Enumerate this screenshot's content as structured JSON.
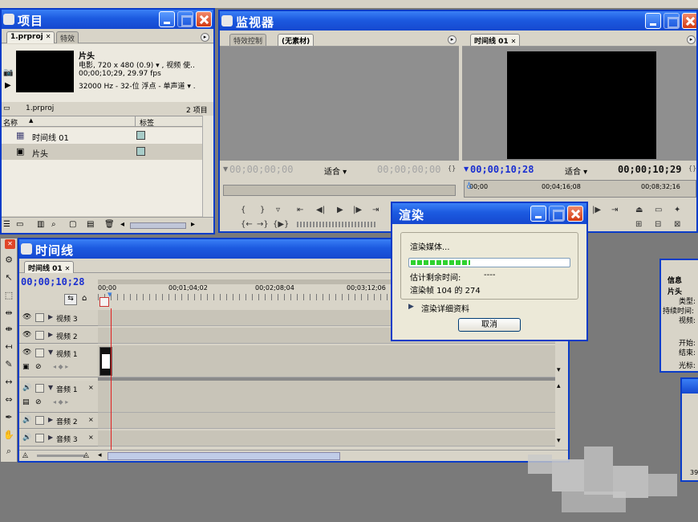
{
  "project": {
    "title": "项目",
    "tab_project": "1.prproj",
    "tab_effects": "特效",
    "clip_name": "片头",
    "clip_info1": "电影, 720 x 480 (0.9)  ▾ , 视频 使..",
    "clip_info2": "00;00;10;29, 29.97 fps",
    "clip_info3": "32000 Hz - 32-位 浮点 - 单声道  ▾ .",
    "bin_name": "1.prproj",
    "item_count": "2 项目",
    "col_name": "名称",
    "col_label": "标签",
    "items": [
      {
        "name": "时间线 01"
      },
      {
        "name": "片头"
      }
    ]
  },
  "monitor": {
    "title": "监视器",
    "tab_effects_ctrl": "特效控制",
    "tab_no_clip": "(无素材)",
    "src_time_left": "00;00;00;00",
    "src_fit": "适合",
    "src_time_right": "00;00;00;00",
    "prog_tab": "时间线 01",
    "prog_time_left": "00;00;10;28",
    "prog_fit": "适合",
    "prog_time_right": "00;00;10;29",
    "ruler": [
      "00;00",
      "00;04;16;08",
      "00;08;32;16"
    ]
  },
  "timeline": {
    "title": "时间线",
    "tab": "时间线 01",
    "timecode": "00;00;10;28",
    "ruler": [
      "00;00",
      "00;01;04;02",
      "00;02;08;04",
      "00;03;12;06"
    ],
    "tracks": [
      {
        "name": "视频 3"
      },
      {
        "name": "视频 2"
      },
      {
        "name": "视频 1"
      },
      {
        "name": "音频 1"
      },
      {
        "name": "音频 2"
      },
      {
        "name": "音频 3"
      }
    ]
  },
  "render_dialog": {
    "title": "渲染",
    "status": "渲染媒体...",
    "progress_fraction": 0.38,
    "eta_label": "估计剩余时间:",
    "eta_value": "----",
    "frames": "渲染帧 104 的 274",
    "details": "渲染详细资料",
    "cancel": "取消"
  },
  "info": {
    "title": "信息",
    "clip": "片头",
    "fields": [
      "类型:",
      "持续时间:",
      "视频:",
      "开始:",
      "结束:",
      "光标:"
    ],
    "bottom_value": "39"
  }
}
